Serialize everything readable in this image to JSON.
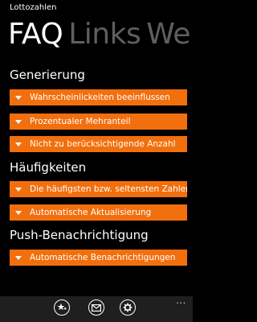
{
  "app": {
    "title": "Lottozahlen"
  },
  "pivot": {
    "headers": [
      "FAQ",
      "Links",
      "Weit"
    ]
  },
  "sections": [
    {
      "title": "Generierung",
      "items": [
        "Wahrscheinlickeiten beeinflussen",
        "Prozentualer Mehranteil",
        "Nicht zu berücksichtigende Anzahl"
      ]
    },
    {
      "title": "Häufigkeiten",
      "items": [
        "Die häufigsten bzw. seltensten Zahlen",
        "Automatische Aktualisierung"
      ]
    },
    {
      "title": "Push-Benachrichtigung",
      "items": [
        "Automatische Benachrichtigungen"
      ]
    }
  ],
  "app_bar": {
    "buttons": [
      "star-add-icon",
      "mail-icon",
      "settings-icon"
    ],
    "more": "..."
  },
  "colors": {
    "accent": "#f26f0e",
    "background": "#000000",
    "inactive_header": "#5f5f5f",
    "app_bar": "#1f1f1f"
  }
}
